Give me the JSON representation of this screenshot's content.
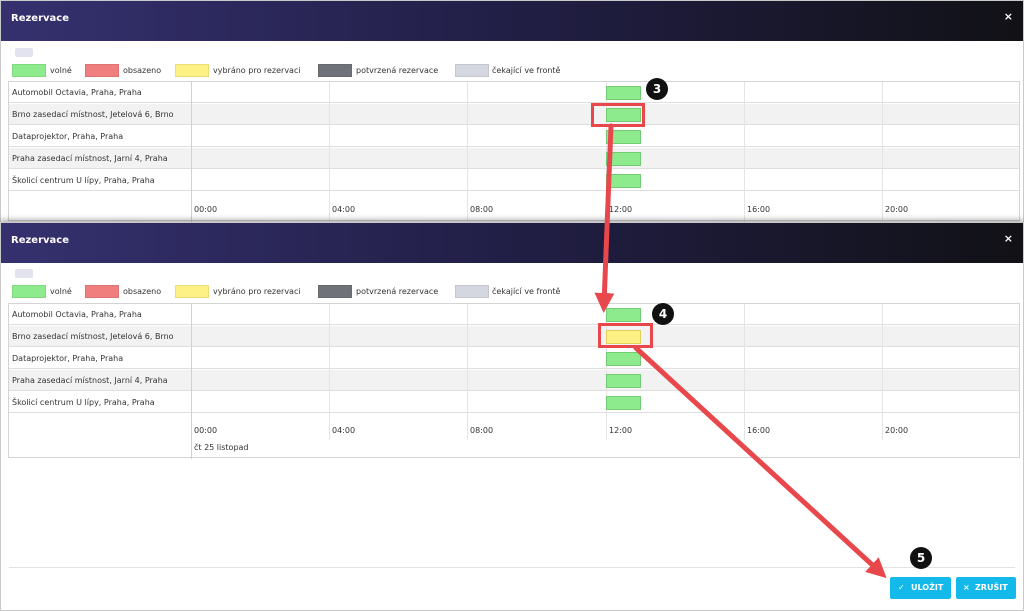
{
  "colors": {
    "free": "#8deb8d",
    "occupied": "#f07e7e",
    "selected": "#fdf084",
    "confirmed": "#6f7278",
    "waiting": "#d4d7df",
    "accent": "#13b9e8",
    "annotation": "#e8474c"
  },
  "dialog": {
    "title": "Rezervace",
    "close_icon": "×",
    "legend": [
      {
        "label": "volné",
        "color": "#8deb8d"
      },
      {
        "label": "obsazeno",
        "color": "#f07e7e"
      },
      {
        "label": "vybráno pro rezervaci",
        "color": "#fdf084"
      },
      {
        "label": "potvrzená rezervace",
        "color": "#6f7278"
      },
      {
        "label": "čekající ve frontě",
        "color": "#d4d7df"
      }
    ],
    "resources": [
      "Automobil Octavia, Praha, Praha",
      "Brno zasedací místnost, Jetelová 6, Brno",
      "Dataprojektor, Praha, Praha",
      "Praha zasedací místnost, Jarní 4, Praha",
      "Školicí centrum U lípy, Praha, Praha"
    ],
    "time_ticks": [
      "00:00",
      "04:00",
      "08:00",
      "12:00",
      "16:00",
      "20:00"
    ],
    "date_label": "čt 25 listopad",
    "selected_resource_index": 1
  },
  "steps": {
    "s3": "3",
    "s4": "4",
    "s5": "5"
  },
  "buttons": {
    "save": "ULOŽIT",
    "cancel": "ZRUŠIT",
    "save_icon": "✓",
    "cancel_icon": "×"
  }
}
